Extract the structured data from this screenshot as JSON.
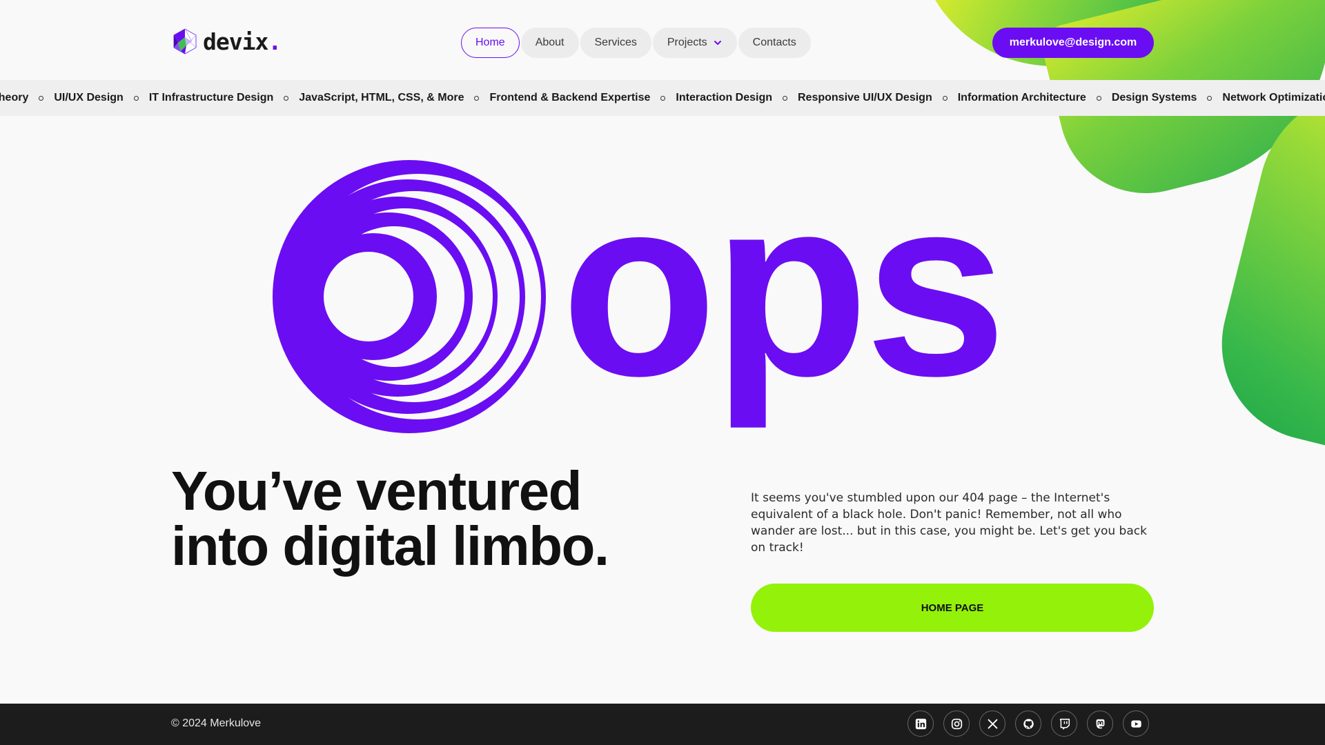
{
  "brand": {
    "name": "devix",
    "dot": ".",
    "accent_color": "#6b0df2",
    "icon": "devix-logo-icon"
  },
  "nav": {
    "items": [
      {
        "label": "Home",
        "active": true
      },
      {
        "label": "About",
        "active": false
      },
      {
        "label": "Services",
        "active": false
      },
      {
        "label": "Projects",
        "active": false,
        "has_dropdown": true
      },
      {
        "label": "Contacts",
        "active": false
      }
    ],
    "email": "merkulove@design.com"
  },
  "ticker": {
    "items": [
      "Theory",
      "UI/UX Design",
      "IT Infrastructure Design",
      "JavaScript, HTML, CSS, & More",
      "Frontend & Backend Expertise",
      "Interaction Design",
      "Responsive UI/UX Design",
      "Information Architecture",
      "Design Systems",
      "Network Optimization"
    ]
  },
  "hero": {
    "oops_text": "ops!",
    "headline": "You’ve ventured into digital limbo.",
    "description": "It seems you've stumbled upon our 404 page – the Internet's equivalent of a black hole. Don't panic! Remember, not all who wander are lost... but in this case, you might be. Let's get you back on track!",
    "button_label": "HOME PAGE",
    "button_color": "#93f10a"
  },
  "footer": {
    "copyright": "© 2024 Merkulove",
    "socials": [
      "linkedin-icon",
      "instagram-icon",
      "x-icon",
      "github-icon",
      "twitch-icon",
      "mastodon-icon",
      "youtube-icon"
    ]
  }
}
